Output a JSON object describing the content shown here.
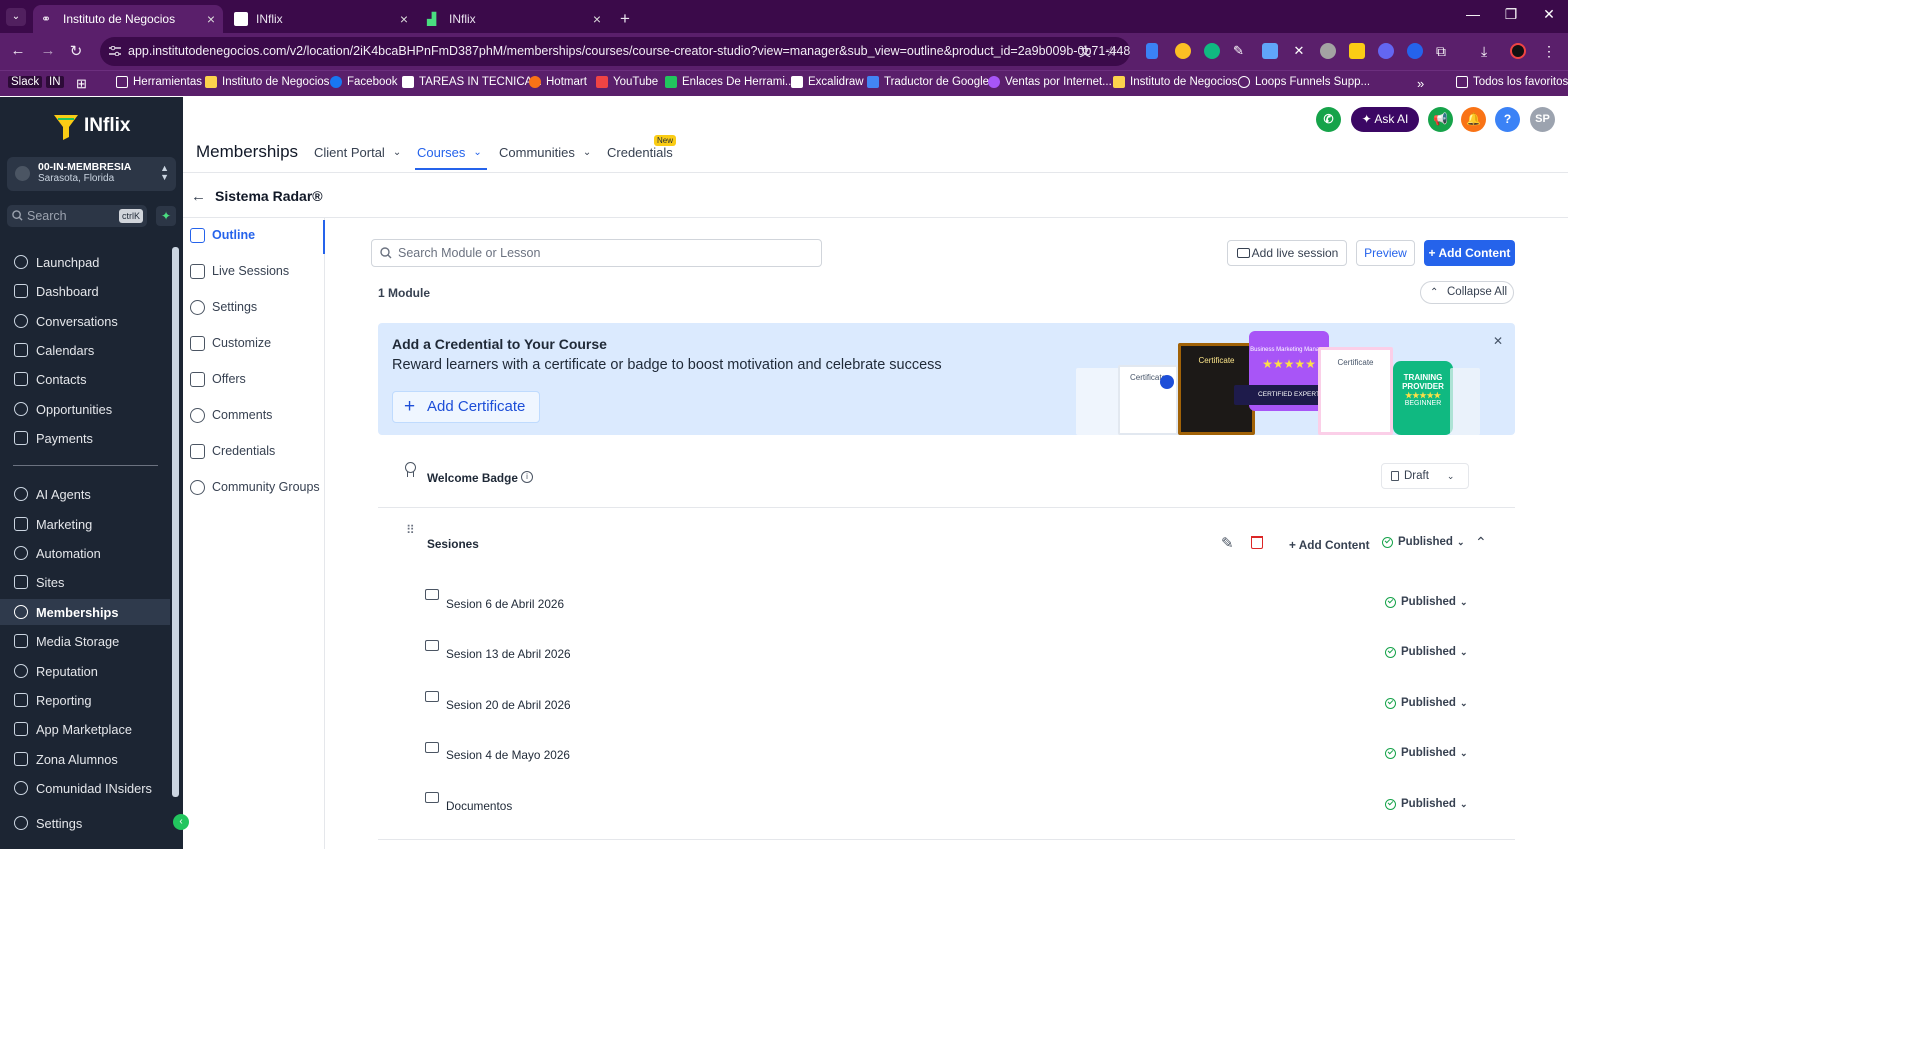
{
  "browser": {
    "tabs": [
      {
        "title": "Instituto de Negocios",
        "active": true
      },
      {
        "title": "INflix",
        "active": false
      },
      {
        "title": "INflix",
        "active": false
      }
    ],
    "url": "app.institutodenegocios.com/v2/location/2iK4bcaBHPnFmD387phM/memberships/courses/course-creator-studio?view=manager&sub_view=outline&product_id=2a9b009b-0b71-448f-...",
    "bookmarks": [
      "Slack",
      "IN",
      "Herramientas",
      "Instituto de Negocios",
      "Facebook",
      "TAREAS IN TECNICA...",
      "Hotmart",
      "YouTube",
      "Enlaces De Herrami...",
      "Excalidraw",
      "Traductor de Google",
      "Ventas por Internet...",
      "Instituto de Negocios",
      "Loops Funnels Supp..."
    ],
    "bookmarks_all": "Todos los favoritos"
  },
  "sidebar": {
    "logo": "INflix",
    "account_name": "00-IN-MEMBRESIA",
    "account_location": "Sarasota, Florida",
    "search_placeholder": "Search",
    "search_shortcut": "ctrlK",
    "items_top": [
      "Launchpad",
      "Dashboard",
      "Conversations",
      "Calendars",
      "Contacts",
      "Opportunities",
      "Payments"
    ],
    "items_bottom": [
      "AI Agents",
      "Marketing",
      "Automation",
      "Sites",
      "Memberships",
      "Media Storage",
      "Reputation",
      "Reporting",
      "App Marketplace",
      "Zona Alumnos",
      "Comunidad INsiders"
    ],
    "settings": "Settings",
    "active": "Memberships"
  },
  "header": {
    "title": "Memberships",
    "tabs": [
      "Client Portal",
      "Courses",
      "Communities",
      "Credentials"
    ],
    "new_badge": "New",
    "ask_ai": "Ask AI",
    "avatar": "SP",
    "help": "?"
  },
  "course": {
    "title": "Sistema Radar®",
    "nav": [
      "Outline",
      "Live Sessions",
      "Settings",
      "Customize",
      "Offers",
      "Comments",
      "Credentials",
      "Community Groups"
    ],
    "active_nav": "Outline"
  },
  "main": {
    "search_placeholder": "Search Module or Lesson",
    "add_live_session": "Add live session",
    "preview": "Preview",
    "add_content": "+ Add Content",
    "module_count": "1 Module",
    "collapse_all": "Collapse All",
    "banner": {
      "title": "Add a Credential to Your Course",
      "text": "Reward learners with a certificate or badge to boost motivation and celebrate success",
      "button": "Add Certificate",
      "images": [
        "Certificate",
        "Certificate",
        "Business Marketing Manager",
        "CERTIFIED EXPERT",
        "Certificate",
        "TRAINING PROVIDER",
        "BEGINNER"
      ]
    },
    "badge_row": {
      "label": "Welcome Badge",
      "status": "Draft"
    },
    "module": {
      "label": "Sesiones",
      "add_content": "+ Add Content",
      "status": "Published"
    },
    "lessons": [
      {
        "label": "Sesion 6 de Abril 2026",
        "status": "Published"
      },
      {
        "label": "Sesion 13 de Abril 2026",
        "status": "Published"
      },
      {
        "label": "Sesion 20 de Abril 2026",
        "status": "Published"
      },
      {
        "label": "Sesion 4 de Mayo 2026",
        "status": "Published"
      },
      {
        "label": "Documentos",
        "status": "Published"
      }
    ]
  },
  "colors": {
    "primary": "#2563eb",
    "sidebar": "#1c2533",
    "browser": "#5a1f6b",
    "published": "#16a34a"
  }
}
